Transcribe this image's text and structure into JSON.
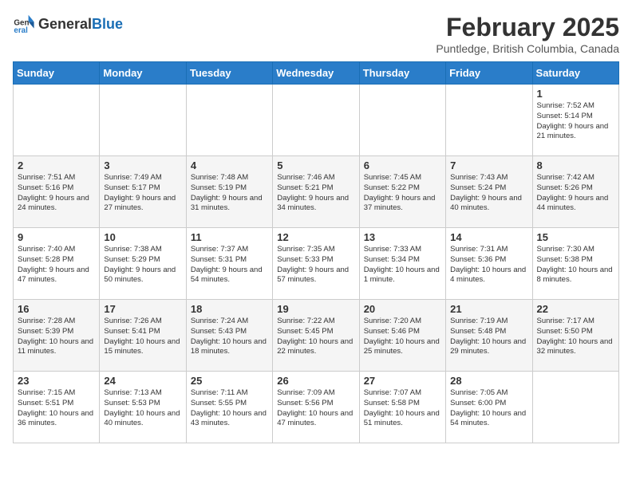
{
  "header": {
    "logo_general": "General",
    "logo_blue": "Blue",
    "month_title": "February 2025",
    "location": "Puntledge, British Columbia, Canada"
  },
  "weekdays": [
    "Sunday",
    "Monday",
    "Tuesday",
    "Wednesday",
    "Thursday",
    "Friday",
    "Saturday"
  ],
  "weeks": [
    [
      {
        "day": "",
        "info": ""
      },
      {
        "day": "",
        "info": ""
      },
      {
        "day": "",
        "info": ""
      },
      {
        "day": "",
        "info": ""
      },
      {
        "day": "",
        "info": ""
      },
      {
        "day": "",
        "info": ""
      },
      {
        "day": "1",
        "info": "Sunrise: 7:52 AM\nSunset: 5:14 PM\nDaylight: 9 hours and 21 minutes."
      }
    ],
    [
      {
        "day": "2",
        "info": "Sunrise: 7:51 AM\nSunset: 5:16 PM\nDaylight: 9 hours and 24 minutes."
      },
      {
        "day": "3",
        "info": "Sunrise: 7:49 AM\nSunset: 5:17 PM\nDaylight: 9 hours and 27 minutes."
      },
      {
        "day": "4",
        "info": "Sunrise: 7:48 AM\nSunset: 5:19 PM\nDaylight: 9 hours and 31 minutes."
      },
      {
        "day": "5",
        "info": "Sunrise: 7:46 AM\nSunset: 5:21 PM\nDaylight: 9 hours and 34 minutes."
      },
      {
        "day": "6",
        "info": "Sunrise: 7:45 AM\nSunset: 5:22 PM\nDaylight: 9 hours and 37 minutes."
      },
      {
        "day": "7",
        "info": "Sunrise: 7:43 AM\nSunset: 5:24 PM\nDaylight: 9 hours and 40 minutes."
      },
      {
        "day": "8",
        "info": "Sunrise: 7:42 AM\nSunset: 5:26 PM\nDaylight: 9 hours and 44 minutes."
      }
    ],
    [
      {
        "day": "9",
        "info": "Sunrise: 7:40 AM\nSunset: 5:28 PM\nDaylight: 9 hours and 47 minutes."
      },
      {
        "day": "10",
        "info": "Sunrise: 7:38 AM\nSunset: 5:29 PM\nDaylight: 9 hours and 50 minutes."
      },
      {
        "day": "11",
        "info": "Sunrise: 7:37 AM\nSunset: 5:31 PM\nDaylight: 9 hours and 54 minutes."
      },
      {
        "day": "12",
        "info": "Sunrise: 7:35 AM\nSunset: 5:33 PM\nDaylight: 9 hours and 57 minutes."
      },
      {
        "day": "13",
        "info": "Sunrise: 7:33 AM\nSunset: 5:34 PM\nDaylight: 10 hours and 1 minute."
      },
      {
        "day": "14",
        "info": "Sunrise: 7:31 AM\nSunset: 5:36 PM\nDaylight: 10 hours and 4 minutes."
      },
      {
        "day": "15",
        "info": "Sunrise: 7:30 AM\nSunset: 5:38 PM\nDaylight: 10 hours and 8 minutes."
      }
    ],
    [
      {
        "day": "16",
        "info": "Sunrise: 7:28 AM\nSunset: 5:39 PM\nDaylight: 10 hours and 11 minutes."
      },
      {
        "day": "17",
        "info": "Sunrise: 7:26 AM\nSunset: 5:41 PM\nDaylight: 10 hours and 15 minutes."
      },
      {
        "day": "18",
        "info": "Sunrise: 7:24 AM\nSunset: 5:43 PM\nDaylight: 10 hours and 18 minutes."
      },
      {
        "day": "19",
        "info": "Sunrise: 7:22 AM\nSunset: 5:45 PM\nDaylight: 10 hours and 22 minutes."
      },
      {
        "day": "20",
        "info": "Sunrise: 7:20 AM\nSunset: 5:46 PM\nDaylight: 10 hours and 25 minutes."
      },
      {
        "day": "21",
        "info": "Sunrise: 7:19 AM\nSunset: 5:48 PM\nDaylight: 10 hours and 29 minutes."
      },
      {
        "day": "22",
        "info": "Sunrise: 7:17 AM\nSunset: 5:50 PM\nDaylight: 10 hours and 32 minutes."
      }
    ],
    [
      {
        "day": "23",
        "info": "Sunrise: 7:15 AM\nSunset: 5:51 PM\nDaylight: 10 hours and 36 minutes."
      },
      {
        "day": "24",
        "info": "Sunrise: 7:13 AM\nSunset: 5:53 PM\nDaylight: 10 hours and 40 minutes."
      },
      {
        "day": "25",
        "info": "Sunrise: 7:11 AM\nSunset: 5:55 PM\nDaylight: 10 hours and 43 minutes."
      },
      {
        "day": "26",
        "info": "Sunrise: 7:09 AM\nSunset: 5:56 PM\nDaylight: 10 hours and 47 minutes."
      },
      {
        "day": "27",
        "info": "Sunrise: 7:07 AM\nSunset: 5:58 PM\nDaylight: 10 hours and 51 minutes."
      },
      {
        "day": "28",
        "info": "Sunrise: 7:05 AM\nSunset: 6:00 PM\nDaylight: 10 hours and 54 minutes."
      },
      {
        "day": "",
        "info": ""
      }
    ]
  ]
}
